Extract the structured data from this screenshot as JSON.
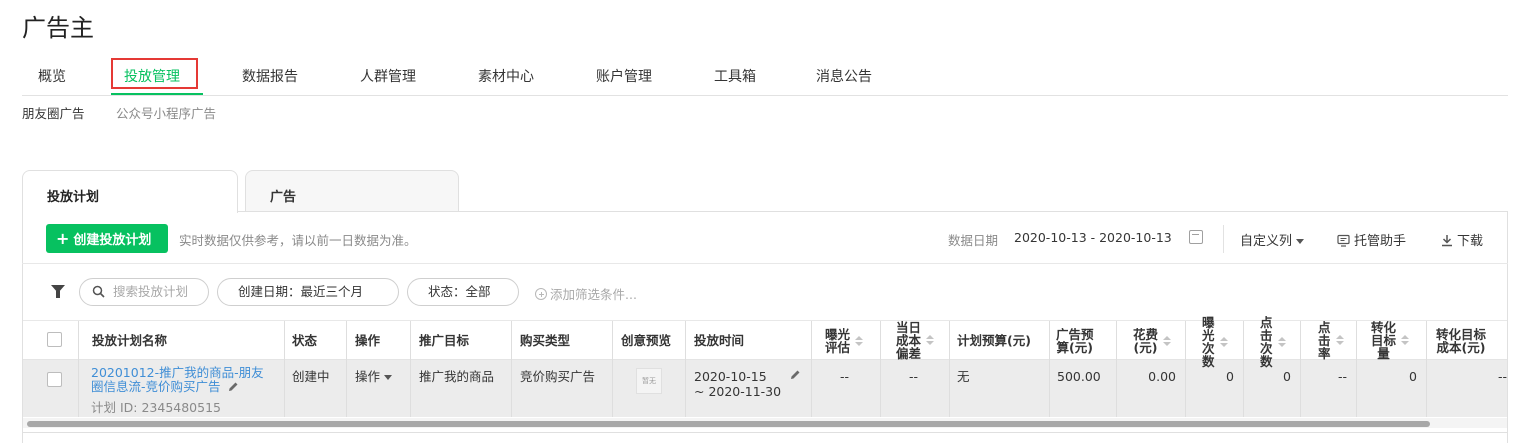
{
  "app_title": "广告主",
  "nav": {
    "tabs": [
      {
        "label": "概览"
      },
      {
        "label": "投放管理"
      },
      {
        "label": "数据报告"
      },
      {
        "label": "人群管理"
      },
      {
        "label": "素材中心"
      },
      {
        "label": "账户管理"
      },
      {
        "label": "工具箱"
      },
      {
        "label": "消息公告"
      }
    ],
    "active_index": 1
  },
  "sub_nav": {
    "items": [
      {
        "label": "朋友圈广告"
      },
      {
        "label": "公众号小程序广告"
      }
    ]
  },
  "card_tabs": [
    {
      "label": "投放计划"
    },
    {
      "label": "广告"
    }
  ],
  "toolbar": {
    "create_button": "创建投放计划",
    "hint": "实时数据仅供参考，请以前一日数据为准。",
    "date_label": "数据日期",
    "date_range": "2020-10-13 - 2020-10-13",
    "custom_columns": "自定义列",
    "assistant": "托管助手",
    "download": "下载"
  },
  "filters": {
    "search_placeholder": "搜索投放计划",
    "create_date": "创建日期：最近三个月",
    "status": "状态：全部",
    "add_filter": "添加筛选条件..."
  },
  "table": {
    "headers": {
      "name": "投放计划名称",
      "status": "状态",
      "action": "操作",
      "target": "推广目标",
      "buy_type": "购买类型",
      "preview": "创意预览",
      "time": "投放时间",
      "exposure_eval": [
        "曝光",
        "评估"
      ],
      "cost_dev": [
        "当日",
        "成本",
        "偏差"
      ],
      "plan_budget": "计划预算(元)",
      "ad_budget": [
        "广告预",
        "算(元)"
      ],
      "spend": [
        "花费",
        "(元)"
      ],
      "impressions": [
        "曝",
        "光",
        "次",
        "数"
      ],
      "clicks": [
        "点",
        "击",
        "次",
        "数"
      ],
      "ctr": [
        "点",
        "击",
        "率"
      ],
      "conv": [
        "转化",
        "目标",
        "量"
      ],
      "conv_cost": [
        "转化目标",
        "成本(元)"
      ]
    },
    "rows": [
      {
        "name": "20201012-推广我的商品-朋友圈信息流-竞价购买广告",
        "plan_id": "计划 ID: 2345480515",
        "status": "创建中",
        "action": "操作",
        "target": "推广我的商品",
        "buy_type": "竞价购买广告",
        "preview": "暂无",
        "time_start": "2020-10-15",
        "time_end": "~ 2020-11-30",
        "exposure_eval": "--",
        "cost_dev": "--",
        "plan_budget": "无",
        "ad_budget": "500.00",
        "spend": "0.00",
        "impressions": "0",
        "clicks": "0",
        "ctr": "--",
        "conv": "0",
        "conv_cost": "--"
      }
    ]
  },
  "colors": {
    "accent": "#07c160",
    "highlight_border": "#e53935",
    "link": "#3f8ed6"
  }
}
